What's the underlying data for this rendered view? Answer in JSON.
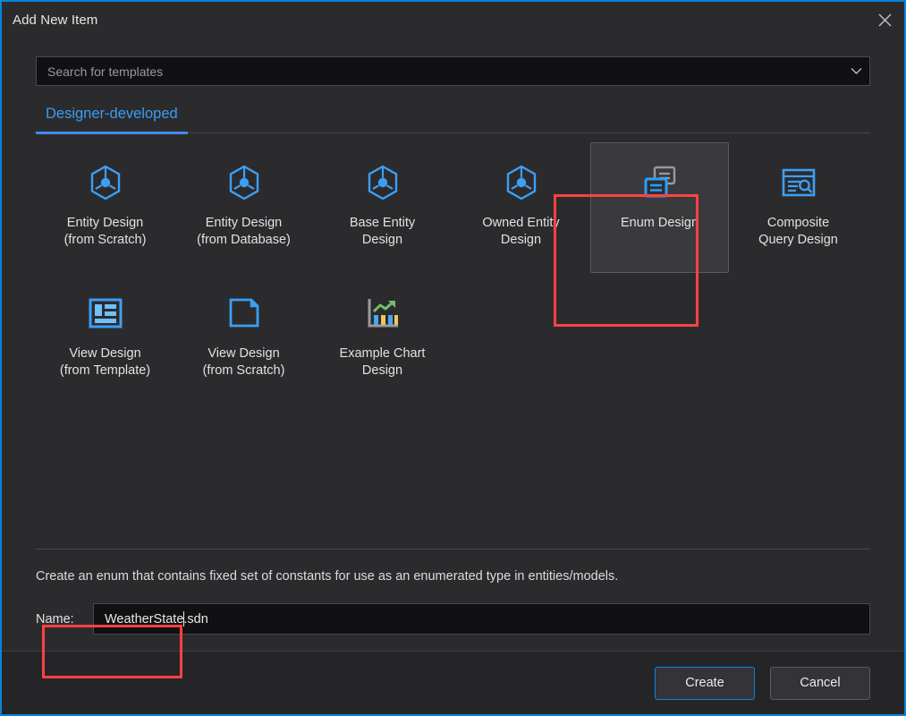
{
  "window": {
    "title": "Add New Item",
    "close_icon": "close-icon",
    "accent_color": "#0a84d8",
    "background_color": "#2b2b2e"
  },
  "search": {
    "placeholder": "Search for templates",
    "value": "",
    "chevron_icon": "chevron-down-icon"
  },
  "tabs": [
    {
      "label": "Designer-developed",
      "active": true
    }
  ],
  "templates": [
    {
      "label": "Entity Design\n(from Scratch)",
      "icon": "entity-hexagon-icon",
      "selected": false
    },
    {
      "label": "Entity Design\n(from Database)",
      "icon": "entity-hexagon-icon",
      "selected": false
    },
    {
      "label": "Base Entity\nDesign",
      "icon": "entity-hexagon-icon",
      "selected": false
    },
    {
      "label": "Owned Entity\nDesign",
      "icon": "entity-hexagon-icon",
      "selected": false
    },
    {
      "label": "Enum Design",
      "icon": "enum-windows-icon",
      "selected": true
    },
    {
      "label": "Composite\nQuery Design",
      "icon": "query-search-icon",
      "selected": false
    },
    {
      "label": "View Design\n(from Template)",
      "icon": "view-layout-icon",
      "selected": false
    },
    {
      "label": "View Design\n(from Scratch)",
      "icon": "blank-page-icon",
      "selected": false
    },
    {
      "label": "Example Chart\nDesign",
      "icon": "chart-growth-icon",
      "selected": false
    }
  ],
  "description": "Create an enum that contains fixed set of constants for use as an enumerated type in entities/models.",
  "name_field": {
    "label": "Name:",
    "value_before_caret": "WeatherState",
    "value_after_caret": ".sdn",
    "full_value": "WeatherState.sdn"
  },
  "footer": {
    "create_label": "Create",
    "cancel_label": "Cancel"
  },
  "annotations": [
    {
      "name": "enum-design-highlight",
      "color": "#ff4242"
    },
    {
      "name": "name-field-highlight",
      "color": "#ff4242"
    }
  ]
}
